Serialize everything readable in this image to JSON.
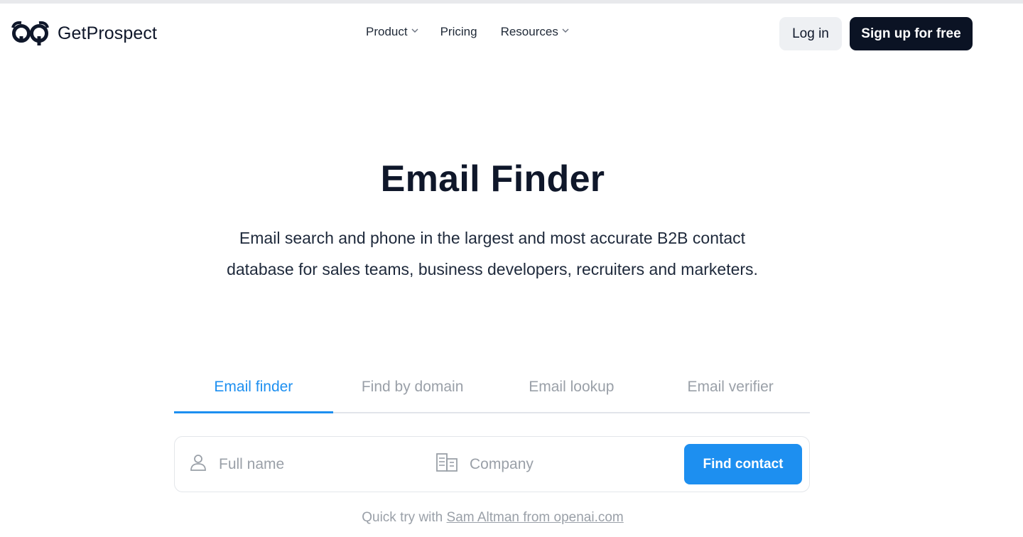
{
  "brand": {
    "name": "GetProspect",
    "logo_icon": "owl-eyes-icon"
  },
  "nav": {
    "items": [
      {
        "label": "Product",
        "has_dropdown": true
      },
      {
        "label": "Pricing",
        "has_dropdown": false
      },
      {
        "label": "Resources",
        "has_dropdown": true
      }
    ]
  },
  "header_actions": {
    "login_label": "Log in",
    "signup_label": "Sign up for free"
  },
  "hero": {
    "title": "Email Finder",
    "subtitle": "Email search and phone in the largest and most accurate B2B contact database for sales teams, business developers, recruiters and marketers."
  },
  "tabs": [
    {
      "label": "Email finder",
      "active": true
    },
    {
      "label": "Find by domain",
      "active": false
    },
    {
      "label": "Email lookup",
      "active": false
    },
    {
      "label": "Email verifier",
      "active": false
    }
  ],
  "search": {
    "full_name_value": "",
    "full_name_placeholder": "Full name",
    "company_value": "",
    "company_placeholder": "Company",
    "submit_label": "Find contact"
  },
  "quick_try": {
    "prefix": "Quick try with ",
    "link_text": "Sam Altman from openai.com"
  },
  "colors": {
    "accent": "#1d8ff0",
    "dark": "#0b1324",
    "muted": "#9aa0a8",
    "light_button": "#eef0f3"
  }
}
